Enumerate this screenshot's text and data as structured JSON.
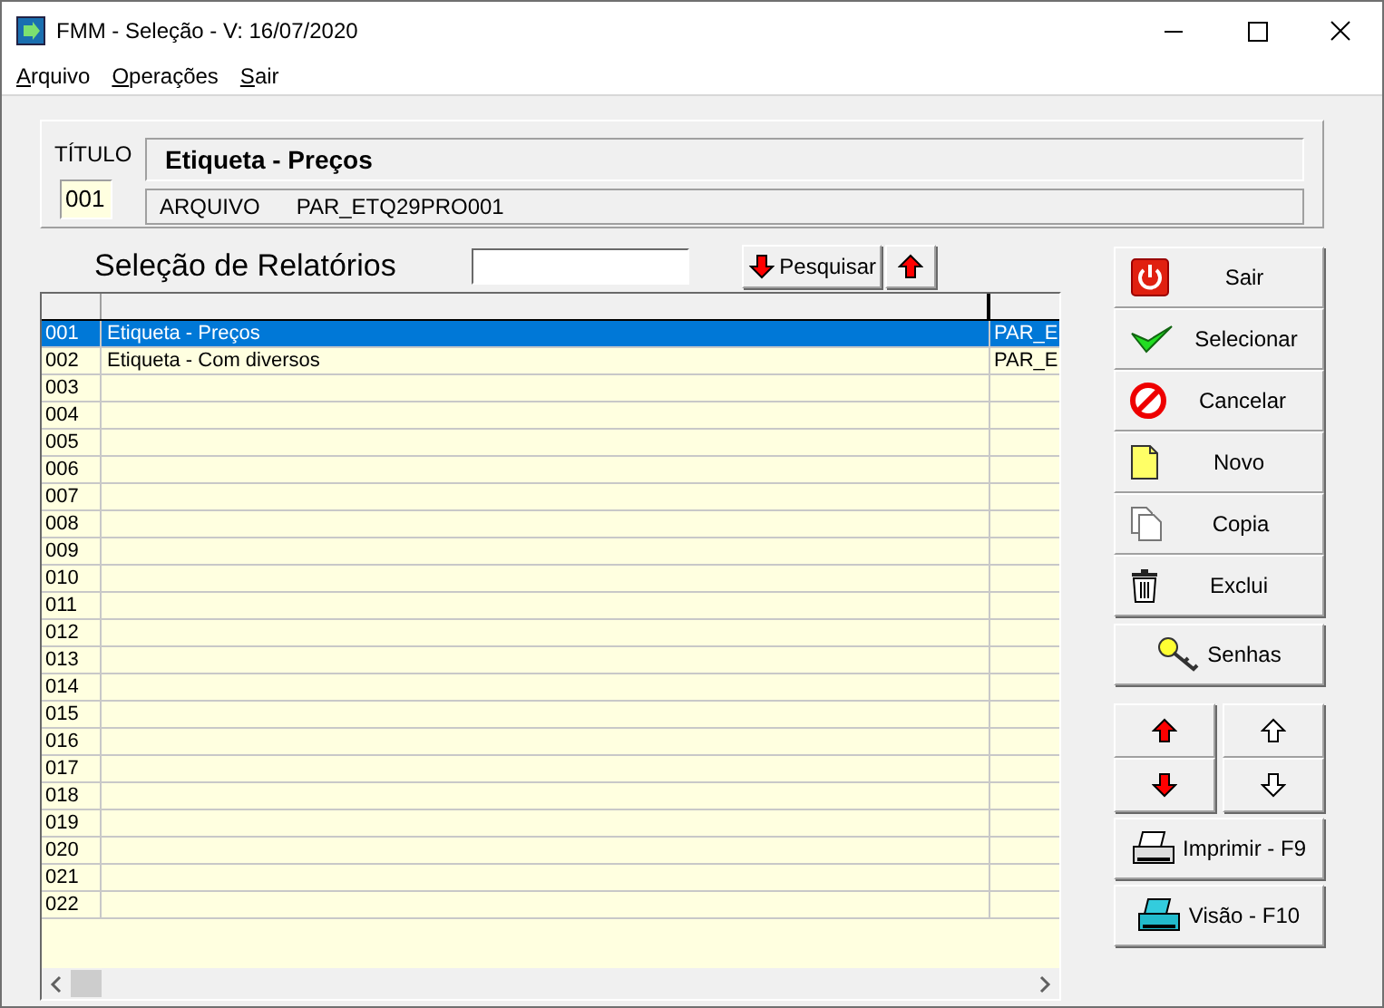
{
  "window": {
    "title": "FMM - Seleção - V: 16/07/2020"
  },
  "menu": [
    "Arquivo",
    "Operações",
    "Sair"
  ],
  "header": {
    "title_label": "TÍTULO",
    "code": "001",
    "title": "Etiqueta - Preços",
    "file_label": "ARQUIVO",
    "file": "PAR_ETQ29PRO001"
  },
  "section_title": "Seleção de Relatórios",
  "search": {
    "button": "Pesquisar"
  },
  "table": {
    "rows": [
      {
        "code": "001",
        "description": "Etiqueta - Preços",
        "column_3": "PAR_E",
        "selected": true
      },
      {
        "code": "002",
        "description": "Etiqueta - Com diversos",
        "column_3": "PAR_E",
        "selected": false
      },
      {
        "code": "003",
        "selected": false
      },
      {
        "code": "004",
        "selected": false
      },
      {
        "code": "005",
        "selected": false
      },
      {
        "code": "006",
        "selected": false
      },
      {
        "code": "007",
        "selected": false
      },
      {
        "code": "008",
        "selected": false
      },
      {
        "code": "009",
        "selected": false
      },
      {
        "code": "010",
        "selected": false
      },
      {
        "code": "011",
        "selected": false
      },
      {
        "code": "012",
        "selected": false
      },
      {
        "code": "013",
        "selected": false
      },
      {
        "code": "014",
        "selected": false
      },
      {
        "code": "015",
        "selected": false
      },
      {
        "code": "016",
        "selected": false
      },
      {
        "code": "017",
        "selected": false
      },
      {
        "code": "018",
        "selected": false
      },
      {
        "code": "019",
        "selected": false
      },
      {
        "code": "020",
        "selected": false
      },
      {
        "code": "021",
        "selected": false
      },
      {
        "code": "022",
        "selected": false
      }
    ]
  },
  "actions": [
    {
      "kind": "exit",
      "label": "Sair"
    },
    {
      "kind": "select",
      "label": "Selecionar"
    },
    {
      "kind": "cancel",
      "label": "Cancelar"
    },
    {
      "kind": "new",
      "label": "Novo"
    },
    {
      "kind": "copy",
      "label": "Copia"
    },
    {
      "kind": "delete",
      "label": "Exclui"
    }
  ],
  "passwords_button": "Senhas",
  "print_buttons": [
    {
      "kind": "print",
      "label": "Imprimir - F9"
    },
    {
      "kind": "preview",
      "label": "Visão - F10"
    }
  ]
}
